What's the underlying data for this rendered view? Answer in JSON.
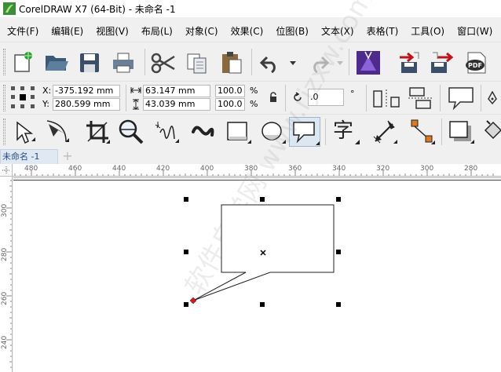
{
  "window": {
    "title": "CorelDRAW X7 (64-Bit) - 未命名 -1"
  },
  "menu": [
    "文件(F)",
    "编辑(E)",
    "视图(V)",
    "布局(L)",
    "对象(C)",
    "效果(C)",
    "位图(B)",
    "文本(X)",
    "表格(T)",
    "工具(O)",
    "窗口(W)"
  ],
  "toolbar_standard": {
    "icons": [
      "new-document-icon",
      "open-icon",
      "save-icon",
      "print-icon",
      "cut-icon",
      "copy-icon",
      "paste-icon",
      "undo-icon",
      "redo-icon",
      "corel-connect-icon",
      "import-icon",
      "export-icon",
      "publish-pdf-icon"
    ]
  },
  "property_bar": {
    "x_label": "X:",
    "x_value": "-375.192 mm",
    "y_label": "Y:",
    "y_value": "280.599 mm",
    "width_value": "63.147 mm",
    "height_value": "43.039 mm",
    "scale_x": "100.0",
    "scale_y": "100.0",
    "percent": "%",
    "rotation_value": ".0",
    "degree": "°"
  },
  "toolbox": {
    "icons": [
      "pick-tool-icon",
      "shape-tool-icon",
      "crop-tool-icon",
      "zoom-tool-icon",
      "freehand-tool-icon",
      "artistic-media-icon",
      "rectangle-tool-icon",
      "ellipse-tool-icon",
      "callout-shape-icon",
      "text-tool-icon",
      "dimension-tool-icon",
      "connector-tool-icon",
      "drop-shadow-icon",
      "fill-tool-icon"
    ],
    "text_tool_glyph": "字"
  },
  "document_tab": {
    "label": "未命名 -1",
    "add": "+"
  },
  "ruler_h": [
    "480",
    "460",
    "440",
    "420",
    "400",
    "380",
    "360",
    "340",
    "320",
    "300",
    "280"
  ],
  "ruler_v": [
    "300",
    "280",
    "260",
    "240"
  ],
  "watermark": "软件自学网 www.rjzxw.com"
}
